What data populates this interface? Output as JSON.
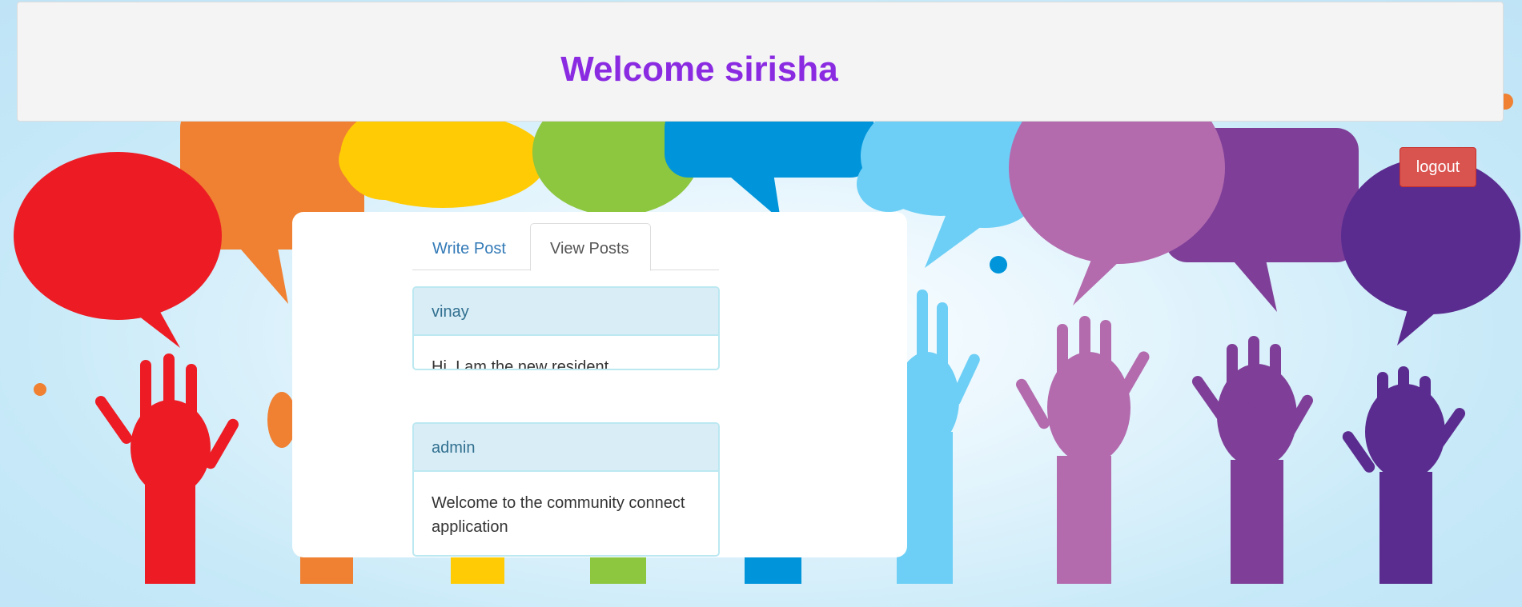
{
  "header": {
    "title": "Welcome sirisha"
  },
  "actions": {
    "logout_label": "logout"
  },
  "tabs": [
    {
      "label": "Write Post",
      "active": false
    },
    {
      "label": "View Posts",
      "active": true
    }
  ],
  "posts": [
    {
      "author": "vinay",
      "message": "Hi ,I am the new resident"
    },
    {
      "author": "admin",
      "message": "Welcome to the community connect application"
    }
  ],
  "colors": {
    "title": "#8a2be2",
    "logout": "#d9534f",
    "panel_heading_bg": "#d9edf7",
    "panel_border": "#bce8f1",
    "link": "#337ab7"
  },
  "background": {
    "description_icons": [
      "speech-bubble-icon",
      "raised-hand-icon"
    ]
  }
}
